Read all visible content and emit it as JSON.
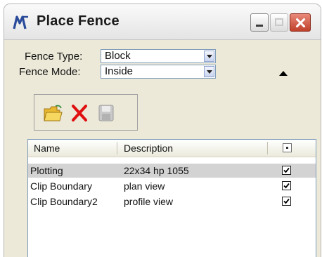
{
  "window": {
    "title": "Place Fence",
    "title_icon": "microstation-logo-icon",
    "controls": [
      "minimize-icon",
      "maximize-icon",
      "close-icon"
    ]
  },
  "settings": {
    "fence_type": {
      "label": "Fence Type:",
      "value": "Block"
    },
    "fence_mode": {
      "label": "Fence Mode:",
      "value": "Inside"
    }
  },
  "toolbar": {
    "icons": [
      "open-folder-icon",
      "delete-icon",
      "save-icon"
    ]
  },
  "fence_list": {
    "columns": [
      "Name",
      "Description"
    ],
    "rows": [
      {
        "name": "Plotting",
        "description": "22x34 hp 1055",
        "checked": true,
        "selected": true
      },
      {
        "name": "Clip Boundary",
        "description": "plan view",
        "checked": true,
        "selected": false
      },
      {
        "name": "Clip Boundary2",
        "description": "profile view",
        "checked": true,
        "selected": false
      }
    ]
  },
  "colors": {
    "dialog_bg": "#ece9d8",
    "selected_row": "#d3d3d3",
    "delete_red": "#e01010",
    "folder_yellow": "#f0c030",
    "close_button": "#c0402a"
  }
}
